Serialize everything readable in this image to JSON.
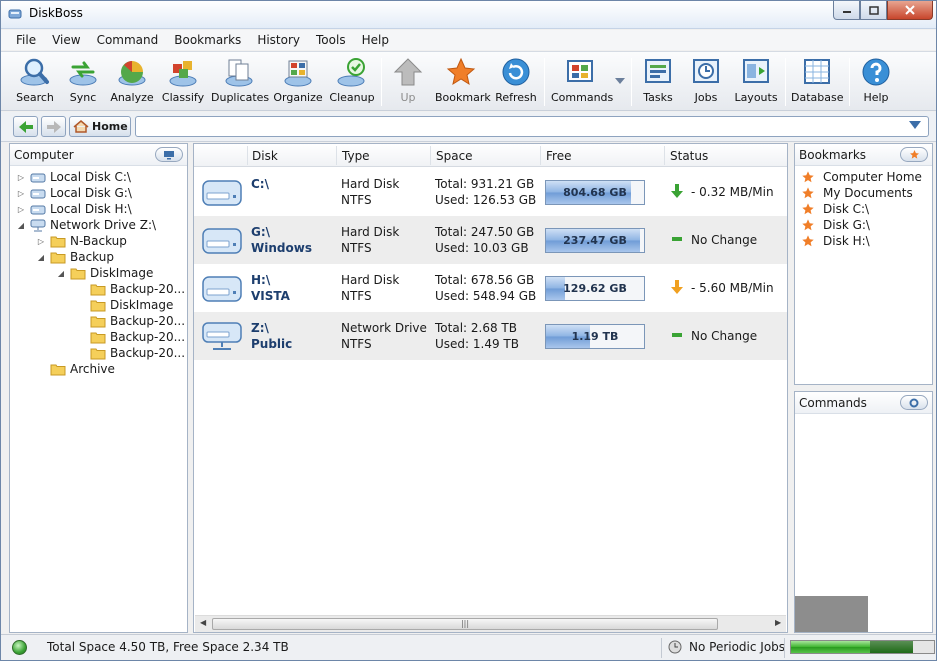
{
  "window": {
    "title": "DiskBoss"
  },
  "menu": [
    "File",
    "View",
    "Command",
    "Bookmarks",
    "History",
    "Tools",
    "Help"
  ],
  "toolbar": {
    "search": "Search",
    "sync": "Sync",
    "analyze": "Analyze",
    "classify": "Classify",
    "duplicates": "Duplicates",
    "organize": "Organize",
    "cleanup": "Cleanup",
    "up": "Up",
    "bookmark": "Bookmark",
    "refresh": "Refresh",
    "commands": "Commands",
    "tasks": "Tasks",
    "jobs": "Jobs",
    "layouts": "Layouts",
    "database": "Database",
    "help": "Help"
  },
  "address": {
    "home_label": "Home",
    "path": ""
  },
  "computer_panel": {
    "title": "Computer",
    "tree": [
      "Local Disk C:\\",
      "Local Disk G:\\",
      "Local Disk H:\\",
      "Network Drive Z:\\",
      "N-Backup",
      "Backup",
      "DiskImage",
      "Backup-20...",
      "DiskImage",
      "Backup-20...",
      "Backup-20...",
      "Backup-20...",
      "Archive"
    ]
  },
  "disk_table": {
    "columns": [
      "Disk",
      "Type",
      "Space",
      "Free",
      "Status"
    ],
    "rows": [
      {
        "disk": "C:\\",
        "label": "",
        "type": "Hard Disk",
        "fs": "NTFS",
        "total": "Total: 931.21 GB",
        "used": "Used: 126.53 GB",
        "free": "804.68 GB",
        "free_fraction": 0.864,
        "status": "- 0.32 MB/Min",
        "status_icon": "arrow-down-green"
      },
      {
        "disk": "G:\\",
        "label": "Windows",
        "type": "Hard Disk",
        "fs": "NTFS",
        "total": "Total: 247.50 GB",
        "used": "Used: 10.03 GB",
        "free": "237.47 GB",
        "free_fraction": 0.959,
        "status": "No Change",
        "status_icon": "dash-green"
      },
      {
        "disk": "H:\\",
        "label": "VISTA",
        "type": "Hard Disk",
        "fs": "NTFS",
        "total": "Total: 678.56 GB",
        "used": "Used: 548.94 GB",
        "free": "129.62 GB",
        "free_fraction": 0.191,
        "status": "- 5.60 MB/Min",
        "status_icon": "arrow-down-orange"
      },
      {
        "disk": "Z:\\",
        "label": "Public",
        "type": "Network Drive",
        "fs": "NTFS",
        "total": "Total: 2.68 TB",
        "used": "Used: 1.49 TB",
        "free": "1.19 TB",
        "free_fraction": 0.444,
        "status": "No Change",
        "status_icon": "dash-green"
      }
    ]
  },
  "bookmarks_panel": {
    "title": "Bookmarks",
    "items": [
      "Computer Home",
      "My Documents",
      "Disk C:\\",
      "Disk G:\\",
      "Disk H:\\"
    ]
  },
  "commands_panel": {
    "title": "Commands"
  },
  "statusbar": {
    "space_text": "Total Space 4.50 TB, Free Space 2.34 TB",
    "jobs_text": "No Periodic Jobs",
    "progress_fraction": 0.55
  },
  "colors": {
    "accent": "#6f9cd6",
    "ok": "#3eb52f",
    "warn": "#f0a020"
  }
}
